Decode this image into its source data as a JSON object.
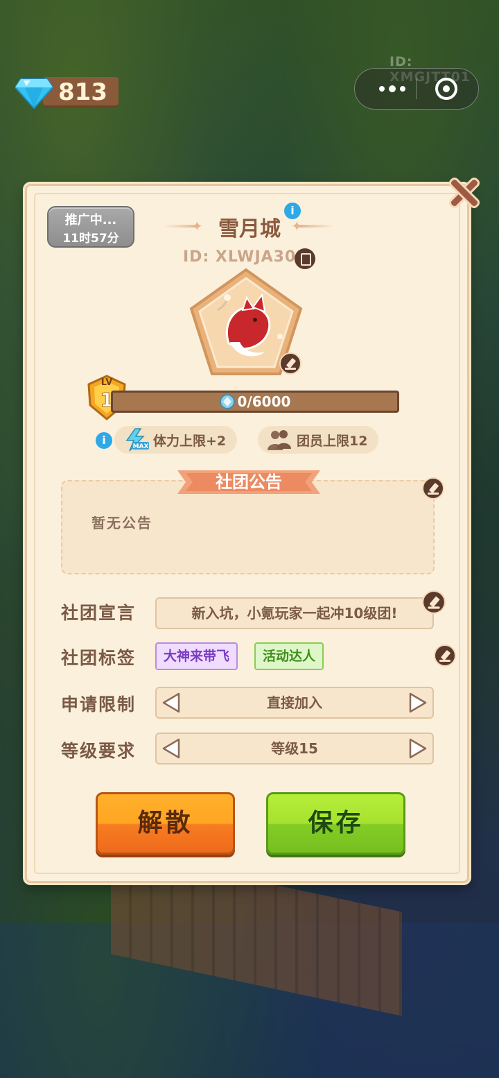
{
  "colors": {
    "accent_blue": "#2ea8e6",
    "panel_bg": "#fbf0dc",
    "title_brown": "#8a5a3e",
    "disband_orange": "#ffa522",
    "save_green": "#a6e22f",
    "tag_purple": "#7b3cc0",
    "tag_green": "#3f8f1c"
  },
  "top_bar": {
    "gem_icon": "diamond-icon",
    "gem_count": "813",
    "user_id": "ID: XMGJTT01",
    "capsule_icons": [
      "more-dots-icon",
      "close-target-icon"
    ]
  },
  "club": {
    "promo_line1": "推广中...",
    "promo_line2": "11时57分",
    "name": "雪月城",
    "id": "ID: XLWJA301",
    "emblem": "fox-emblem-icon",
    "level_label": "LV",
    "level": "1",
    "exp_text": "0/6000",
    "exp_progress": 0,
    "perks": [
      {
        "icon": "lightning-max-icon",
        "label": "体力上限+2"
      },
      {
        "icon": "members-icon",
        "label": "团员上限12"
      }
    ]
  },
  "notice": {
    "title": "社团公告",
    "content": "暂无公告"
  },
  "form": {
    "declaration_label": "社团宣言",
    "declaration_value": "新入坑，小氪玩家一起冲10级团!",
    "tags_label": "社团标签",
    "tags": [
      "大神来带飞",
      "活动达人"
    ],
    "apply_label": "申请限制",
    "apply_value": "直接加入",
    "level_label": "等级要求",
    "level_value": "等级15"
  },
  "buttons": {
    "disband": "解散",
    "save": "保存"
  }
}
